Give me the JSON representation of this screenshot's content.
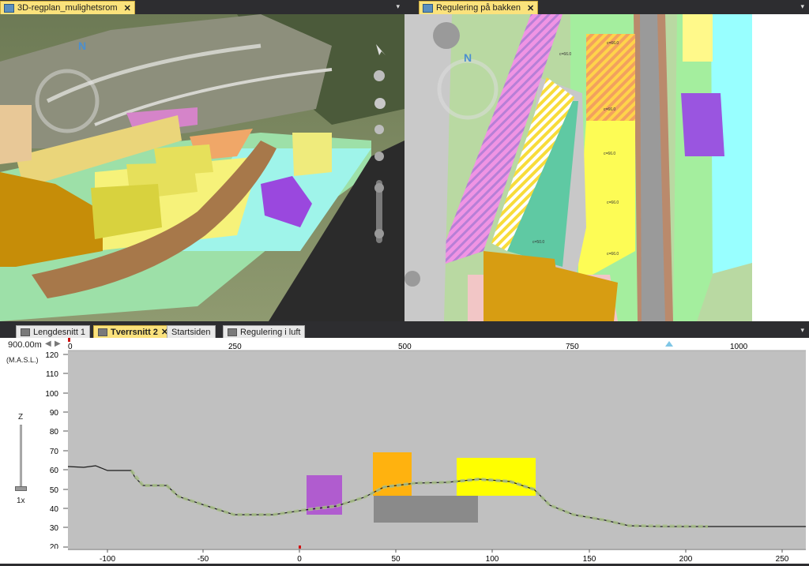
{
  "left_pane": {
    "tab_label": "3D-regplan_mulighetsrom",
    "compass_label": "N"
  },
  "right_pane": {
    "tab_label": "Regulering på bakken",
    "compass_label": "N",
    "plan_labels": [
      "c=66.0",
      "c=66.0",
      "c=66.0",
      "c=66.0",
      "c=66.0",
      "c=66.0",
      "c=50.0"
    ]
  },
  "bottom_tabs": [
    {
      "label": "Lengdesnitt 1",
      "active": false
    },
    {
      "label": "Tverrsnitt 2",
      "active": true
    },
    {
      "label": "Startsiden",
      "active": false
    },
    {
      "label": "Regulering i luft",
      "active": false
    }
  ],
  "section": {
    "position_readout": "900.00m",
    "height_ref": "(M.A.S.L.)",
    "zoom_label": "Z",
    "zoom_value": "1x",
    "ruler_ticks": [
      "0",
      "250",
      "500",
      "750",
      "1000"
    ],
    "y_ticks": [
      "120",
      "110",
      "100",
      "90",
      "80",
      "70",
      "60",
      "50",
      "40",
      "30",
      "20"
    ],
    "x_ticks": [
      "-100",
      "-50",
      "0",
      "50",
      "100",
      "150",
      "200",
      "250"
    ],
    "colors": {
      "purple": "#b05ccf",
      "orange": "#ffb20f",
      "yellow": "#ffff00",
      "grey": "#8a8a8a",
      "background": "#c0c0c0"
    }
  }
}
